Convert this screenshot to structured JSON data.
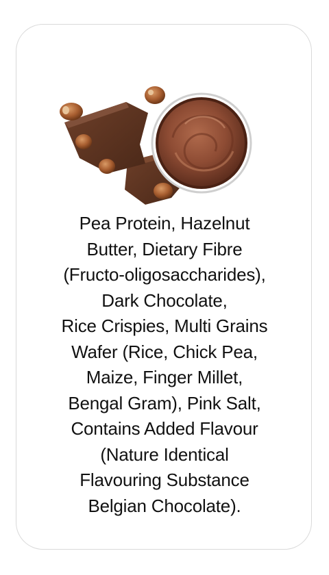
{
  "ingredients": {
    "lines": [
      "Pea Protein, Hazelnut",
      "Butter, Dietary Fibre",
      "(Fructo-oligosaccharides),",
      "Dark Chocolate,",
      "Rice Crispies, Multi Grains",
      "Wafer (Rice, Chick Pea,",
      "Maize, Finger Millet,",
      "Bengal Gram), Pink Salt,",
      "Contains Added Flavour",
      "(Nature Identical",
      "Flavouring Substance",
      "Belgian Chocolate)."
    ]
  },
  "colors": {
    "chocolate": "#5a3220",
    "spread": "#8a4a32",
    "hazelnut": "#a0582e",
    "card_border": "#d9d9d9"
  },
  "illustration": {
    "icon": "chocolate-hazelnut-spread-image"
  }
}
